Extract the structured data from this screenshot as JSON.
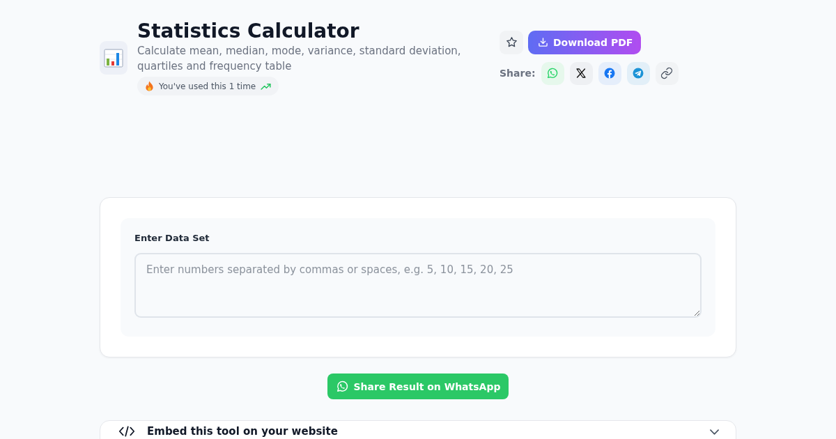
{
  "header": {
    "title": "Statistics Calculator",
    "subtitle": "Calculate mean, median, mode, variance, standard deviation, quartiles and frequency table",
    "usage_badge": "You've used this 1 time"
  },
  "actions": {
    "download_button": "Download PDF",
    "share_label": "Share:",
    "share_buttons": [
      {
        "kind": "whatsapp"
      },
      {
        "kind": "x"
      },
      {
        "kind": "facebook"
      },
      {
        "kind": "telegram"
      },
      {
        "kind": "link"
      }
    ]
  },
  "input_card": {
    "label": "Enter Data Set",
    "placeholder": "Enter numbers separated by commas or spaces, e.g. 5, 10, 15, 20, 25"
  },
  "whatsapp_button": "Share Result on WhatsApp",
  "embed_section": {
    "title": "Embed this tool on your website",
    "expanded": false
  }
}
